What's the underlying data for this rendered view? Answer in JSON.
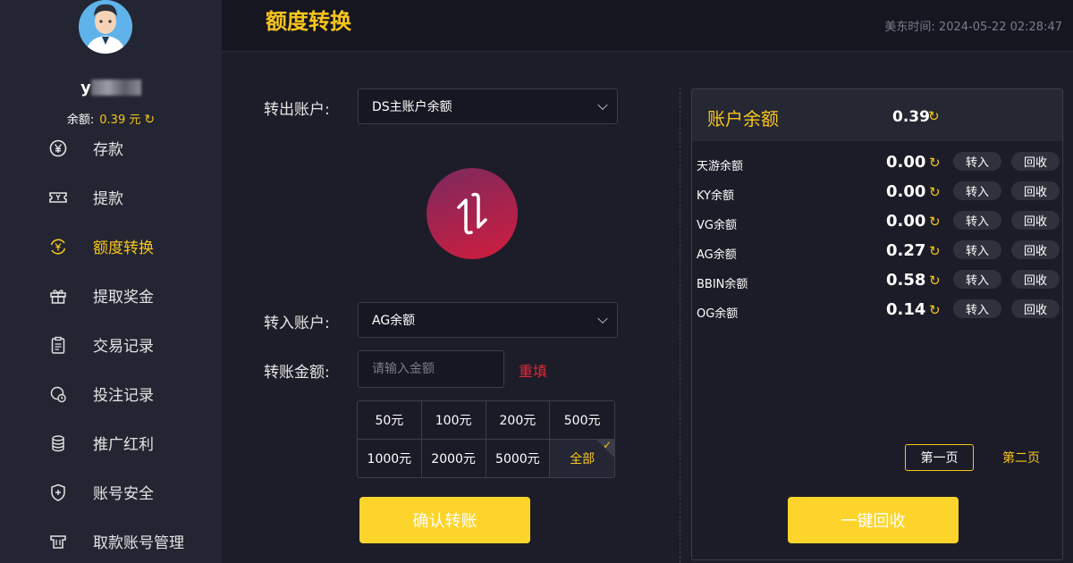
{
  "sidebar": {
    "username": "y",
    "balance_label": "余额:",
    "balance_value": "0.39 元",
    "items": [
      {
        "label": "存款",
        "icon": "yen-circle-icon"
      },
      {
        "label": "提款",
        "icon": "ticket-icon"
      },
      {
        "label": "额度转换",
        "icon": "yen-swap-icon",
        "active": true
      },
      {
        "label": "提取奖金",
        "icon": "gift-icon"
      },
      {
        "label": "交易记录",
        "icon": "clipboard-icon"
      },
      {
        "label": "投注记录",
        "icon": "bet-record-icon"
      },
      {
        "label": "推广红利",
        "icon": "coin-stack-icon"
      },
      {
        "label": "账号安全",
        "icon": "shield-icon"
      },
      {
        "label": "取款账号管理",
        "icon": "card-icon"
      }
    ]
  },
  "header": {
    "title": "额度转换",
    "time": "美东时间: 2024-05-22 02:28:47"
  },
  "form": {
    "from_label": "转出账户:",
    "from_value": "DS主账户余额",
    "to_label": "转入账户:",
    "to_value": "AG余额",
    "amount_label": "转账金额:",
    "amount_placeholder": "请输入金额",
    "reset_label": "重填",
    "quick_amounts": [
      "50元",
      "100元",
      "200元",
      "500元",
      "1000元",
      "2000元",
      "5000元",
      "全部"
    ],
    "selected_amount": "全部",
    "confirm_label": "确认转账"
  },
  "accounts": {
    "title": "账户余额",
    "total": "0.39",
    "transfer_in_label": "转入",
    "reclaim_label": "回收",
    "rows": [
      {
        "name": "天游余额",
        "value": "0.00"
      },
      {
        "name": "KY余额",
        "value": "0.00"
      },
      {
        "name": "VG余额",
        "value": "0.00"
      },
      {
        "name": "AG余额",
        "value": "0.27"
      },
      {
        "name": "BBIN余额",
        "value": "0.58"
      },
      {
        "name": "OG余额",
        "value": "0.14"
      }
    ],
    "page1_label": "第一页",
    "page2_label": "第二页",
    "reclaim_all_label": "一键回收"
  },
  "colors": {
    "accent": "#f8c51c",
    "danger": "#e0283a",
    "background": "#1c1d28",
    "sidebar": "#232532"
  }
}
